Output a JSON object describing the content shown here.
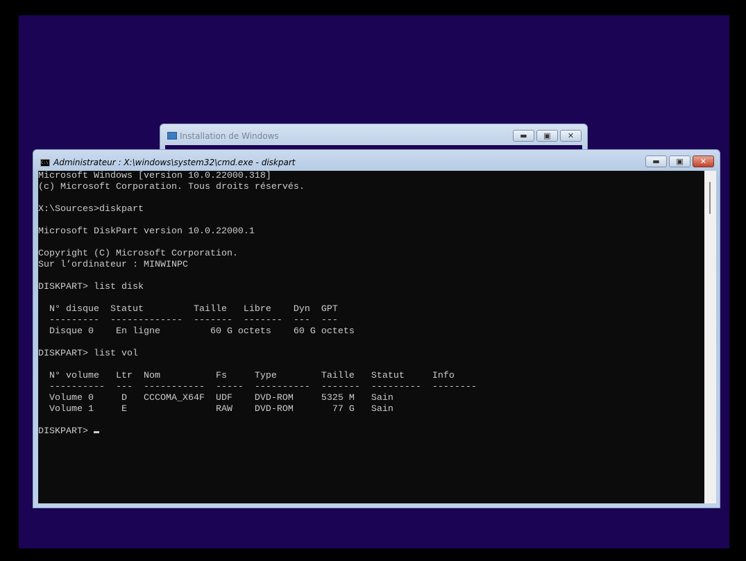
{
  "setup_window": {
    "title": "Installation de Windows"
  },
  "cmd_window": {
    "title": "Administrateur : X:\\windows\\system32\\cmd.exe - diskpart",
    "lines": [
      "Microsoft Windows [version 10.0.22000.318]",
      "(c) Microsoft Corporation. Tous droits réservés.",
      "",
      "X:\\Sources>diskpart",
      "",
      "Microsoft DiskPart version 10.0.22000.1",
      "",
      "Copyright (C) Microsoft Corporation.",
      "Sur l’ordinateur : MINWINPC",
      "",
      "DISKPART> list disk",
      "",
      "  N° disque  Statut         Taille   Libre    Dyn  GPT",
      "  ---------  -------------  -------  -------  ---  ---",
      "  Disque 0    En ligne         60 G octets    60 G octets",
      "",
      "DISKPART> list vol",
      "",
      "  N° volume   Ltr  Nom          Fs     Type        Taille   Statut     Info",
      "  ----------  ---  -----------  -----  ----------  -------  ---------  --------",
      "  Volume 0     D   CCCOMA_X64F  UDF    DVD-ROM     5325 M   Sain",
      "  Volume 1     E                RAW    DVD-ROM       77 G   Sain",
      ""
    ],
    "prompt": "DISKPART> "
  },
  "buttons": {
    "minimize": "▬",
    "maximize": "▣",
    "close": "✕"
  }
}
